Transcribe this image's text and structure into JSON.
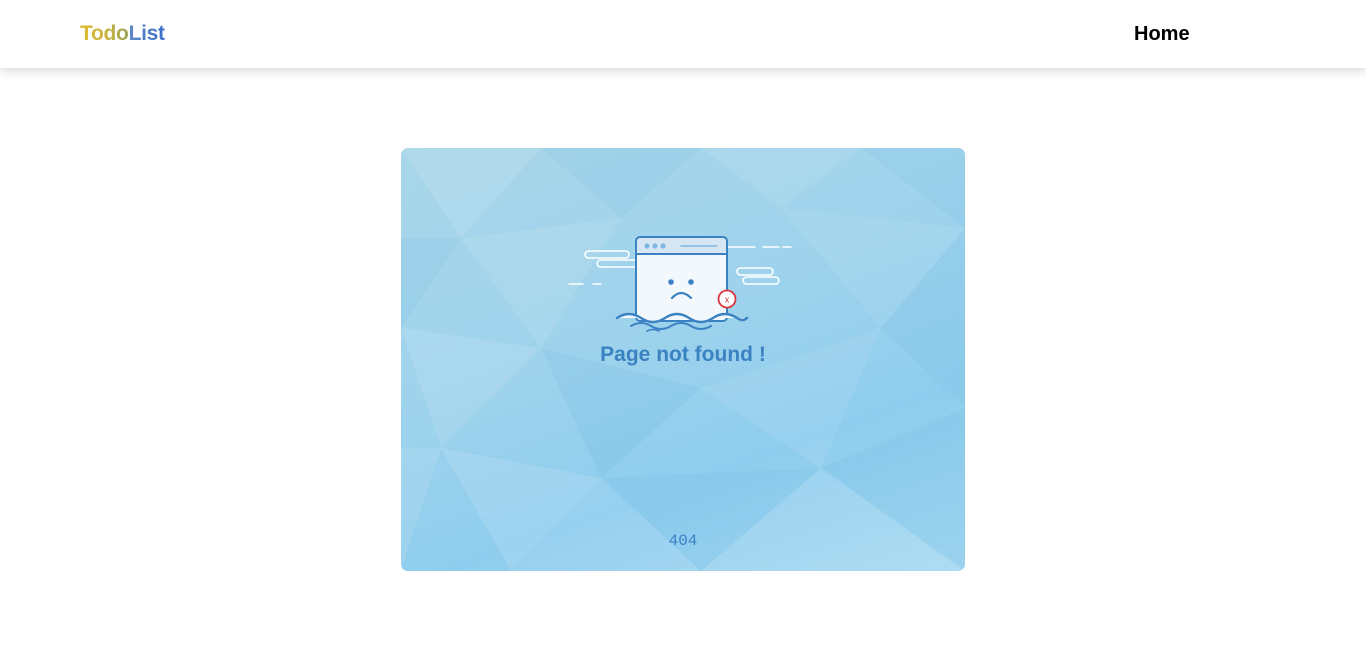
{
  "navbar": {
    "brand_part1": "Todo",
    "brand_part2": "List",
    "home_label": "Home"
  },
  "error": {
    "title": "Page not found !",
    "code": "404",
    "badge_mark": "x"
  },
  "colors": {
    "accent": "#3b82c2",
    "card_background": "#9fd3ec",
    "error_badge": "#d9363e",
    "brand_todo": "#d4b437",
    "brand_list": "#3b6fc8"
  },
  "icons": {
    "illustration": "sad-browser-window-icon",
    "badge": "error-x-icon"
  }
}
